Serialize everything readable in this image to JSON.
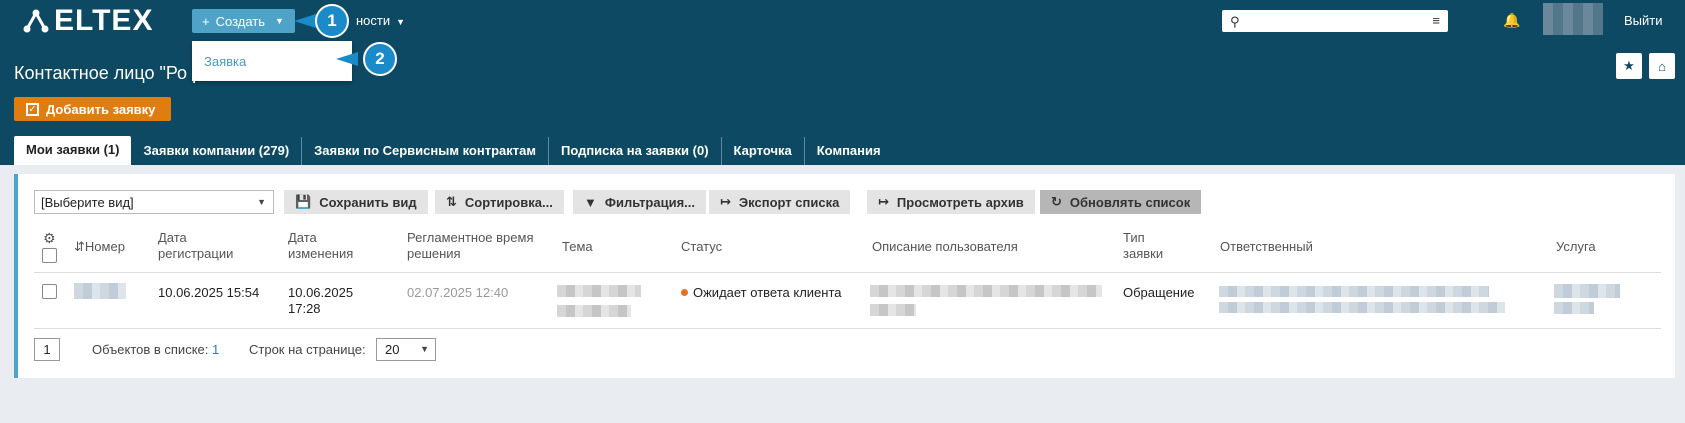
{
  "header": {
    "logo_text": "ELTEX",
    "create_label": "Создать",
    "nav_fragment": "ности",
    "logout": "Выйти",
    "search": {
      "value": "",
      "placeholder": ""
    }
  },
  "dropdown": {
    "items": [
      "Заявка"
    ]
  },
  "callouts": [
    "1",
    "2"
  ],
  "page": {
    "title": "Контактное лицо \"Ро                 р           г Клиент\"",
    "add_request": "Добавить заявку"
  },
  "tabs": [
    "Мои заявки (1)",
    "Заявки компании (279)",
    "Заявки по Сервисным контрактам",
    "Подписка на заявки (0)",
    "Карточка",
    "Компания"
  ],
  "toolbar": {
    "view_select": "[Выберите вид]",
    "save_view": "Сохранить вид",
    "sort": "Сортировка...",
    "filter": "Фильтрация...",
    "export": "Экспорт списка",
    "archive": "Просмотреть архив",
    "refresh": "Обновлять список"
  },
  "table": {
    "columns": {
      "number": "Номер",
      "reg_date": "Дата регистрации",
      "mod_date": "Дата изменения",
      "deadline": "Регламентное время решения",
      "topic": "Тема",
      "status": "Статус",
      "description": "Описание пользователя",
      "type": "Тип заявки",
      "responsible": "Ответственный",
      "service": "Услуга"
    },
    "rows": [
      {
        "reg_date": "10.06.2025 15:54",
        "mod_date": "10.06.2025 17:28",
        "deadline": "02.07.2025 12:40",
        "status": "Ожидает ответа клиента",
        "type": "Обращение"
      }
    ]
  },
  "footer": {
    "page": "1",
    "objects_label": "Объектов в списке:",
    "objects_count": "1",
    "per_page_label": "Строк на странице:",
    "per_page_value": "20"
  },
  "colors": {
    "header_bg": "#0d4962",
    "accent": "#4fa3c8",
    "add_button": "#e07d10",
    "callout": "#1a8ac8",
    "status_dot": "#e8711f"
  }
}
